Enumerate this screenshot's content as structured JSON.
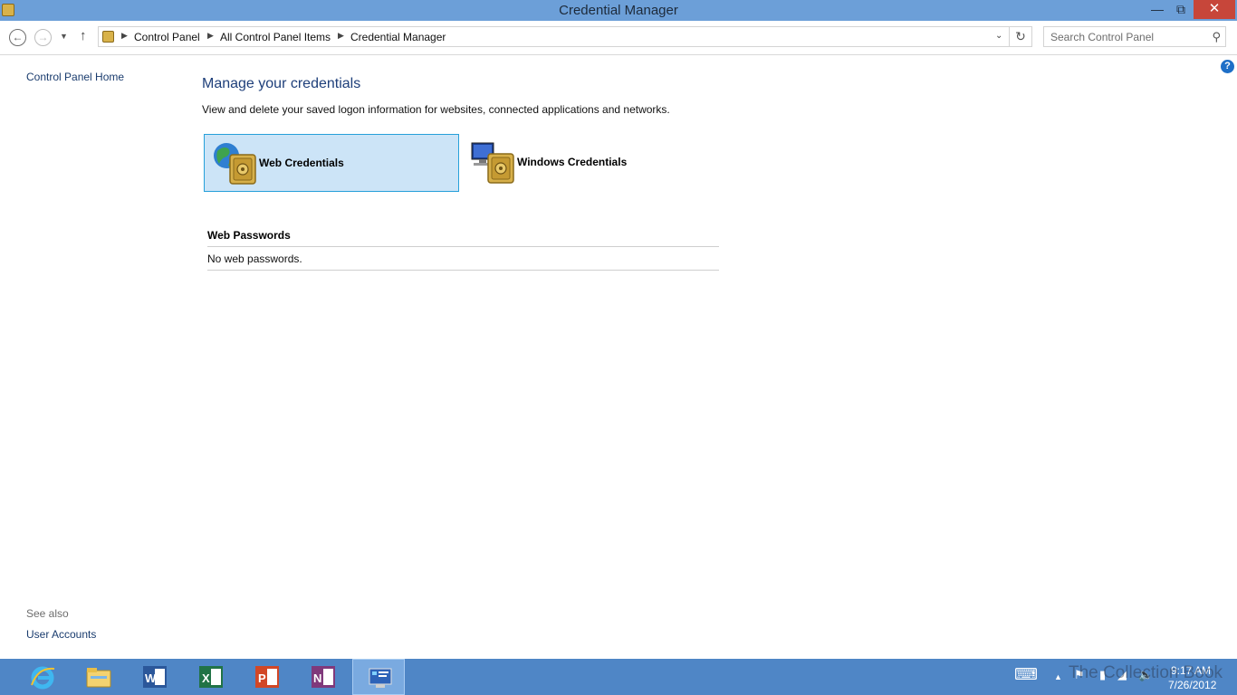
{
  "window": {
    "title": "Credential Manager",
    "minimize_icon": "minimize-icon",
    "maximize_icon": "restore-icon",
    "close_icon": "close-icon"
  },
  "nav": {
    "breadcrumb": [
      "Control Panel",
      "All Control Panel Items",
      "Credential Manager"
    ],
    "search_placeholder": "Search Control Panel"
  },
  "left_pane": {
    "home_link": "Control Panel Home",
    "see_also_label": "See also",
    "see_also_links": [
      "User Accounts"
    ]
  },
  "main": {
    "heading": "Manage your credentials",
    "description": "View and delete your saved logon information for websites, connected applications and networks.",
    "tiles": [
      {
        "label": "Web Credentials",
        "selected": true,
        "icon": "web-credentials-vault-icon"
      },
      {
        "label": "Windows Credentials",
        "selected": false,
        "icon": "windows-credentials-vault-icon"
      }
    ],
    "section_title": "Web Passwords",
    "empty_message": "No web passwords."
  },
  "taskbar": {
    "apps": [
      "internet-explorer-icon",
      "file-explorer-icon",
      "word-icon",
      "excel-icon",
      "powerpoint-icon",
      "onenote-icon",
      "control-panel-icon"
    ],
    "active_app": "control-panel-icon",
    "clock_time": "9:17 AM",
    "clock_date": "7/26/2012"
  },
  "watermark": "The Collection Book",
  "colors": {
    "titlebar": "#6c9fd8",
    "taskbar": "#4f86c6",
    "selected_tile": "#cce4f7",
    "selected_tile_border": "#26a0da",
    "link": "#1a3c6e",
    "heading": "#1e3f7a",
    "close_button": "#c7463a"
  }
}
